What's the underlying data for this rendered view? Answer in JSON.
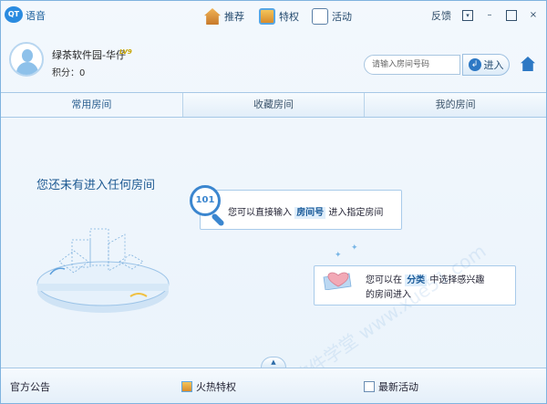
{
  "app": {
    "logo_text": "QT",
    "title": "语音"
  },
  "nav": {
    "recommend": "推荐",
    "privileges": "特权",
    "events": "活动"
  },
  "window_controls": {
    "feedback": "反馈",
    "dropdown": "▾",
    "minimize": "–",
    "maximize": "□",
    "close": "×"
  },
  "profile": {
    "username": "绿茶软件园-华仔",
    "level_badge": "LV9",
    "points_label": "积分：0"
  },
  "search": {
    "placeholder": "请输入房间号码",
    "enter_label": "进入",
    "enter_arrow": "↲"
  },
  "tabs": [
    {
      "label": "常用房间"
    },
    {
      "label": "收藏房间"
    },
    {
      "label": "我的房间"
    }
  ],
  "main": {
    "empty_message": "您还未有进入任何房间",
    "hint1": {
      "badge": "101",
      "prefix": "您可以直接输入",
      "highlight": "房间号",
      "suffix": "进入指定房间"
    },
    "hint2": {
      "prefix": "您可以在",
      "highlight": "分类",
      "middle": "中选择感兴趣",
      "line2": "的房间进入"
    }
  },
  "bottom": {
    "collapse_arrow": "▲",
    "notice": "官方公告",
    "hot": "火热特权",
    "news": "最新活动"
  },
  "watermark": "软件学堂 www.xue51.com",
  "colors": {
    "accent": "#2d78c4",
    "border": "#a6c8e6",
    "highlight_bg": "#dfeefb"
  }
}
